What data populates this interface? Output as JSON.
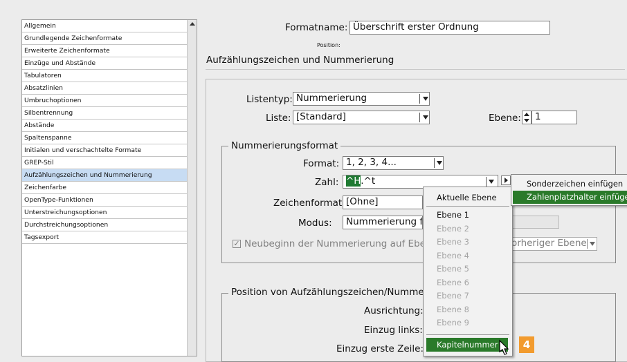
{
  "left_list": {
    "items": [
      {
        "label": "Allgemein",
        "selected": false
      },
      {
        "label": "Grundlegende Zeichenformate",
        "selected": false
      },
      {
        "label": "Erweiterte Zeichenformate",
        "selected": false
      },
      {
        "label": "Einzüge und Abstände",
        "selected": false
      },
      {
        "label": "Tabulatoren",
        "selected": false
      },
      {
        "label": "Absatzlinien",
        "selected": false
      },
      {
        "label": "Umbruchoptionen",
        "selected": false
      },
      {
        "label": "Silbentrennung",
        "selected": false
      },
      {
        "label": "Abstände",
        "selected": false
      },
      {
        "label": "Spaltenspanne",
        "selected": false
      },
      {
        "label": "Initialen und verschachtelte Formate",
        "selected": false
      },
      {
        "label": "GREP-Stil",
        "selected": false
      },
      {
        "label": "Aufzählungszeichen und Nummerierung",
        "selected": true
      },
      {
        "label": "Zeichenfarbe",
        "selected": false
      },
      {
        "label": "OpenType-Funktionen",
        "selected": false
      },
      {
        "label": "Unterstreichungsoptionen",
        "selected": false
      },
      {
        "label": "Durchstreichungsoptionen",
        "selected": false
      },
      {
        "label": "Tagsexport",
        "selected": false
      }
    ]
  },
  "header": {
    "formatname_label": "Formatname:",
    "formatname_value": "Überschrift erster Ordnung",
    "position_label": "Position:",
    "section_title": "Aufzählungszeichen und Nummerierung"
  },
  "list_settings": {
    "listentyp_label": "Listentyp:",
    "listentyp_value": "Nummerierung",
    "liste_label": "Liste:",
    "liste_value": "[Standard]",
    "ebene_label": "Ebene:",
    "ebene_value": "1"
  },
  "numbering_format": {
    "legend": "Nummerierungsformat",
    "format_label": "Format:",
    "format_value": "1, 2, 3, 4...",
    "zahl_label": "Zahl:",
    "zahl_value_selected": "^H",
    "zahl_value_rest": ".^t",
    "zeichenformat_label": "Zeichenformat:",
    "zeichenformat_value": "[Ohne]",
    "modus_label": "Modus:",
    "modus_value": "Nummerierung fo",
    "restart_label": "Neubeginn der Nummerierung auf Ebene",
    "restart_checked": true,
    "after_level_value": "orheriger Ebene"
  },
  "position_group": {
    "legend": "Position von Aufzählungszeichen/Nummerie",
    "ausrichtung_label": "Ausrichtung:",
    "einzug_links_label": "Einzug links:",
    "einzug_erste_label": "Einzug erste Zeile:"
  },
  "popup_menu": {
    "header": "Aktuelle Ebene",
    "items": [
      {
        "label": "Ebene 1",
        "enabled": true
      },
      {
        "label": "Ebene 2",
        "enabled": false
      },
      {
        "label": "Ebene 3",
        "enabled": false
      },
      {
        "label": "Ebene 4",
        "enabled": false
      },
      {
        "label": "Ebene 5",
        "enabled": false
      },
      {
        "label": "Ebene 6",
        "enabled": false
      },
      {
        "label": "Ebene 7",
        "enabled": false
      },
      {
        "label": "Ebene 8",
        "enabled": false
      },
      {
        "label": "Ebene 9",
        "enabled": false
      }
    ],
    "highlighted": "Kapitelnummer"
  },
  "submenu": {
    "item1": "Sonderzeichen einfügen",
    "item2": "Zahlenplatzhalter einfügen"
  },
  "badge": "4",
  "colors": {
    "highlight": "#2a7a2a",
    "selection": "#c7dcf3",
    "badge": "#f29b2e",
    "zahl_selection": "#1f7a32"
  }
}
